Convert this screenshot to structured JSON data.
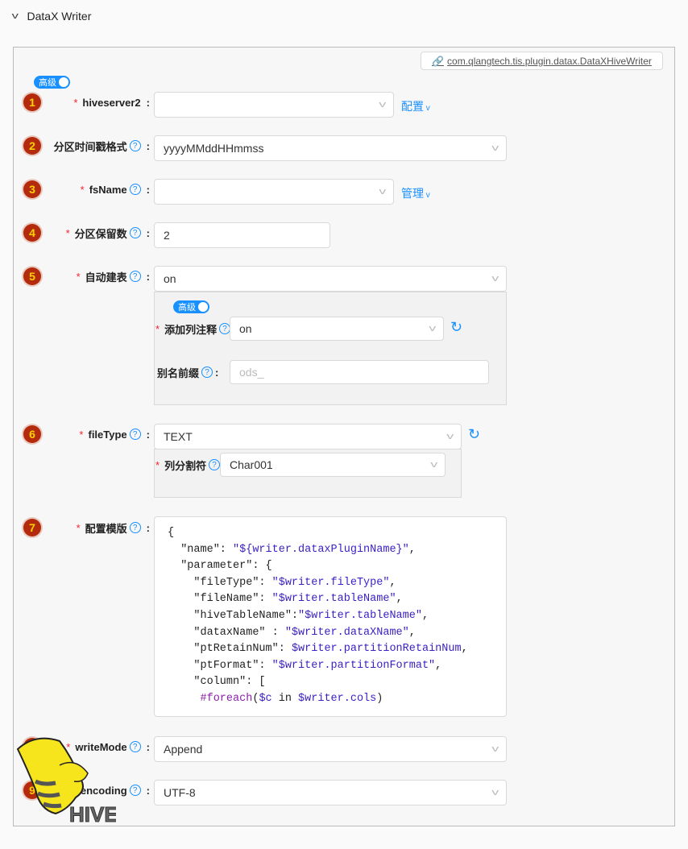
{
  "header": {
    "title": "DataX Writer"
  },
  "plugin_class": "com.qlangtech.tis.plugin.datax.DataXHiveWriter",
  "advanced_toggle": "高级",
  "fields": [
    {
      "num": "1",
      "label": "hiveserver2",
      "value": "",
      "action": "配置"
    },
    {
      "num": "2",
      "label": "分区时间戳格式",
      "value": "yyyyMMddHHmmss"
    },
    {
      "num": "3",
      "label": "fsName",
      "value": "",
      "action": "管理"
    },
    {
      "num": "4",
      "label": "分区保留数",
      "value": "2"
    },
    {
      "num": "5",
      "label": "自动建表",
      "value": "on"
    },
    {
      "num": "6",
      "label": "fileType",
      "value": "TEXT"
    },
    {
      "num": "7",
      "label": "配置模版"
    },
    {
      "num": "8",
      "label": "writeMode",
      "value": "Append"
    },
    {
      "num": "9",
      "label": "encoding",
      "value": "UTF-8"
    }
  ],
  "auto_create": {
    "toggle": "高级",
    "col_comment_label": "添加列注释",
    "col_comment_value": "on",
    "alias_label": "别名前缀",
    "alias_placeholder": "ods_"
  },
  "file_type_sub": {
    "label": "列分割符",
    "value": "Char001"
  },
  "template": [
    [
      [
        "{",
        ""
      ]
    ],
    [
      [
        "  \"name\": ",
        ""
      ],
      [
        "\"${writer.dataxPluginName}\"",
        "v"
      ],
      [
        ",",
        ""
      ]
    ],
    [
      [
        "  \"parameter\": {",
        ""
      ]
    ],
    [
      [
        "    \"fileType\": ",
        ""
      ],
      [
        "\"$writer.fileType\"",
        "v"
      ],
      [
        ",",
        ""
      ]
    ],
    [
      [
        "    \"fileName\": ",
        ""
      ],
      [
        "\"$writer.tableName\"",
        "v"
      ],
      [
        ",",
        ""
      ]
    ],
    [
      [
        "    \"hiveTableName\":",
        ""
      ],
      [
        "\"$writer.tableName\"",
        "v"
      ],
      [
        ",",
        ""
      ]
    ],
    [
      [
        "    \"dataxName\" : ",
        ""
      ],
      [
        "\"$writer.dataXName\"",
        "v"
      ],
      [
        ",",
        ""
      ]
    ],
    [
      [
        "    \"ptRetainNum\": ",
        ""
      ],
      [
        "$writer.partitionRetainNum",
        "v"
      ],
      [
        ",",
        ""
      ]
    ],
    [
      [
        "    \"ptFormat\": ",
        ""
      ],
      [
        "\"$writer.partitionFormat\"",
        "v"
      ],
      [
        ",",
        ""
      ]
    ],
    [
      [
        "    \"column\": [",
        ""
      ]
    ],
    [
      [
        "     #foreach",
        "d"
      ],
      [
        "(",
        ""
      ],
      [
        "$c",
        "v"
      ],
      [
        " in ",
        ""
      ],
      [
        "$writer.cols",
        "v"
      ],
      [
        ")",
        ""
      ]
    ]
  ],
  "logo_text": "HIVE"
}
